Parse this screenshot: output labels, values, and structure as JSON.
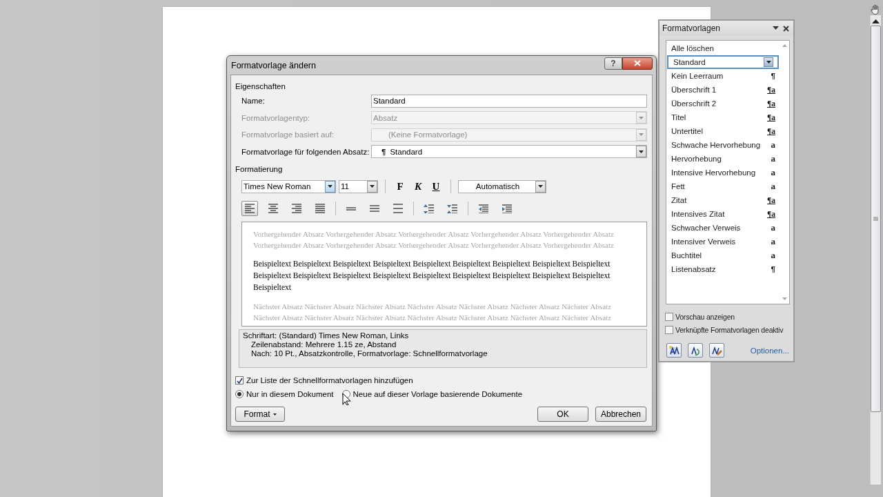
{
  "dialog": {
    "title": "Formatvorlage ändern",
    "help_button": "?",
    "properties": {
      "heading": "Eigenschaften",
      "fields": [
        {
          "label": "Name:",
          "value": "Standard",
          "kind": "text",
          "disabled": false
        },
        {
          "label": "Formatvorlagentyp:",
          "value": "Absatz",
          "kind": "dropdown",
          "disabled": true
        },
        {
          "label": "Formatvorlage basiert auf:",
          "value": "(Keine Formatvorlage)",
          "kind": "dropdown",
          "disabled": true
        },
        {
          "label": "Formatvorlage für folgenden Absatz:",
          "value": "Standard",
          "prefix": "¶",
          "kind": "dropdown",
          "disabled": false
        }
      ]
    },
    "formatting": {
      "heading": "Formatierung",
      "font": "Times New Roman",
      "size": "11",
      "style_buttons": [
        {
          "label": "F",
          "kind": "bold"
        },
        {
          "label": "K",
          "kind": "italic"
        },
        {
          "label": "U",
          "kind": "underline"
        }
      ],
      "text_color": "Automatisch",
      "paragraph_buttons": [
        {
          "kind": "align-left",
          "selected": true
        },
        {
          "kind": "align-center",
          "selected": false
        },
        {
          "kind": "align-right",
          "selected": false
        },
        {
          "kind": "align-justify",
          "selected": false
        },
        {
          "kind": "line-single",
          "selected": false
        },
        {
          "kind": "line-onehalf",
          "selected": false
        },
        {
          "kind": "line-double",
          "selected": false
        },
        {
          "kind": "space-more",
          "selected": false
        },
        {
          "kind": "space-less",
          "selected": false
        },
        {
          "kind": "indent-decrease",
          "selected": false
        },
        {
          "kind": "indent-increase",
          "selected": false
        }
      ]
    },
    "preview": {
      "previous_paragraph": "Vorhergehender Absatz Vorhergehender Absatz Vorhergehender Absatz Vorhergehender Absatz Vorhergehender Absatz Vorhergehender Absatz Vorhergehender Absatz Vorhergehender Absatz Vorhergehender Absatz Vorhergehender Absatz",
      "sample_text": "Beispieltext Beispieltext Beispieltext Beispieltext Beispieltext Beispieltext Beispieltext Beispieltext Beispieltext Beispieltext Beispieltext Beispieltext Beispieltext Beispieltext Beispieltext Beispieltext Beispieltext Beispieltext Beispieltext",
      "next_paragraph": "Nächster Absatz Nächster Absatz Nächster Absatz Nächster Absatz Nächster Absatz Nächster Absatz Nächster Absatz Nächster Absatz Nächster Absatz Nächster Absatz Nächster Absatz Nächster Absatz Nächster Absatz Nächster Absatz"
    },
    "description": [
      "Schriftart: (Standard) Times New Roman, Links",
      "Zeilenabstand:  Mehrere 1.15 ze, Abstand",
      "Nach:  10 Pt., Absatzkontrolle, Formatvorlage: Schnellformatvorlage"
    ],
    "add_to_quick_styles": {
      "label": "Zur Liste der Schnellformatvorlagen hinzufügen",
      "checked": true
    },
    "scope_options": [
      {
        "label": "Nur in diesem Dokument",
        "selected": true
      },
      {
        "label": "Neue auf dieser Vorlage basierende Dokumente",
        "selected": false
      }
    ],
    "format_button": "Format",
    "ok_button": "OK",
    "cancel_button": "Abbrechen"
  },
  "styles_pane": {
    "title": "Formatvorlagen",
    "styles": [
      {
        "label": "Alle löschen",
        "selected": false
      },
      {
        "label": "Standard",
        "selected": true
      },
      {
        "label": "Kein Leerraum",
        "kind": "paragraph",
        "symbol": "¶",
        "selected": false
      },
      {
        "label": "Überschrift 1",
        "kind": "linked",
        "symbol": "¶a",
        "selected": false
      },
      {
        "label": "Überschrift 2",
        "kind": "linked",
        "symbol": "¶a",
        "selected": false
      },
      {
        "label": "Titel",
        "kind": "linked",
        "symbol": "¶a",
        "selected": false
      },
      {
        "label": "Untertitel",
        "kind": "linked",
        "symbol": "¶a",
        "selected": false
      },
      {
        "label": "Schwache Hervorhebung",
        "kind": "character",
        "symbol": "a",
        "selected": false
      },
      {
        "label": "Hervorhebung",
        "kind": "character",
        "symbol": "a",
        "selected": false
      },
      {
        "label": "Intensive Hervorhebung",
        "kind": "character",
        "symbol": "a",
        "selected": false
      },
      {
        "label": "Fett",
        "kind": "character",
        "symbol": "a",
        "selected": false
      },
      {
        "label": "Zitat",
        "kind": "linked",
        "symbol": "¶a",
        "selected": false
      },
      {
        "label": "Intensives Zitat",
        "kind": "linked",
        "symbol": "¶a",
        "selected": false
      },
      {
        "label": "Schwacher Verweis",
        "kind": "character",
        "symbol": "a",
        "selected": false
      },
      {
        "label": "Intensiver Verweis",
        "kind": "character",
        "symbol": "a",
        "selected": false
      },
      {
        "label": "Buchtitel",
        "kind": "character",
        "symbol": "a",
        "selected": false
      },
      {
        "label": "Listenabsatz",
        "kind": "paragraph",
        "symbol": "¶",
        "selected": false
      }
    ],
    "options": [
      {
        "label": "Vorschau anzeigen",
        "checked": false
      },
      {
        "label": "Verknüpfte Formatvorlagen deaktiv",
        "checked": false
      }
    ],
    "options_link": "Optionen..."
  }
}
